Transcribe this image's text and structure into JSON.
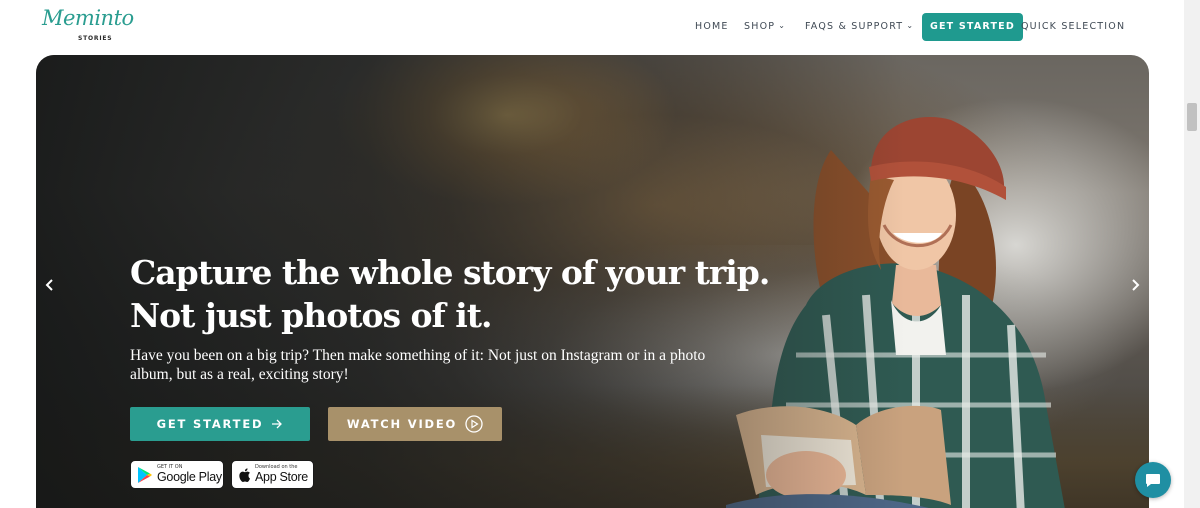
{
  "brand": {
    "name": "Meminto",
    "sub": "STORIES",
    "color": "#2a9d90"
  },
  "nav": {
    "home": "HOME",
    "shop": "SHOP",
    "faqs": "FAQS & SUPPORT",
    "get_started": "GET STARTED",
    "quick": "QUICK SELECTION"
  },
  "hero": {
    "headline_line1": "Capture the whole story of your trip.",
    "headline_line2": "Not just photos of it.",
    "subtext_line1": "Have you been on a big trip? Then make something of it: Not just on Instagram or in a photo",
    "subtext_line2": "album, but as a real, exciting story!",
    "cta_primary": "GET STARTED",
    "cta_secondary": "WATCH VIDEO",
    "google_small": "GET IT ON",
    "google_big": "Google Play",
    "apple_small": "Download on the",
    "apple_big": "App Store"
  },
  "colors": {
    "accent": "#2a9d90",
    "gold": "#a8916a",
    "chat": "#1f8fa3"
  },
  "icons": [
    "chevron-down-icon",
    "arrow-right-icon",
    "play-circle-icon",
    "google-play-icon",
    "apple-icon",
    "chat-icon",
    "chevron-left-icon",
    "chevron-right-icon"
  ]
}
